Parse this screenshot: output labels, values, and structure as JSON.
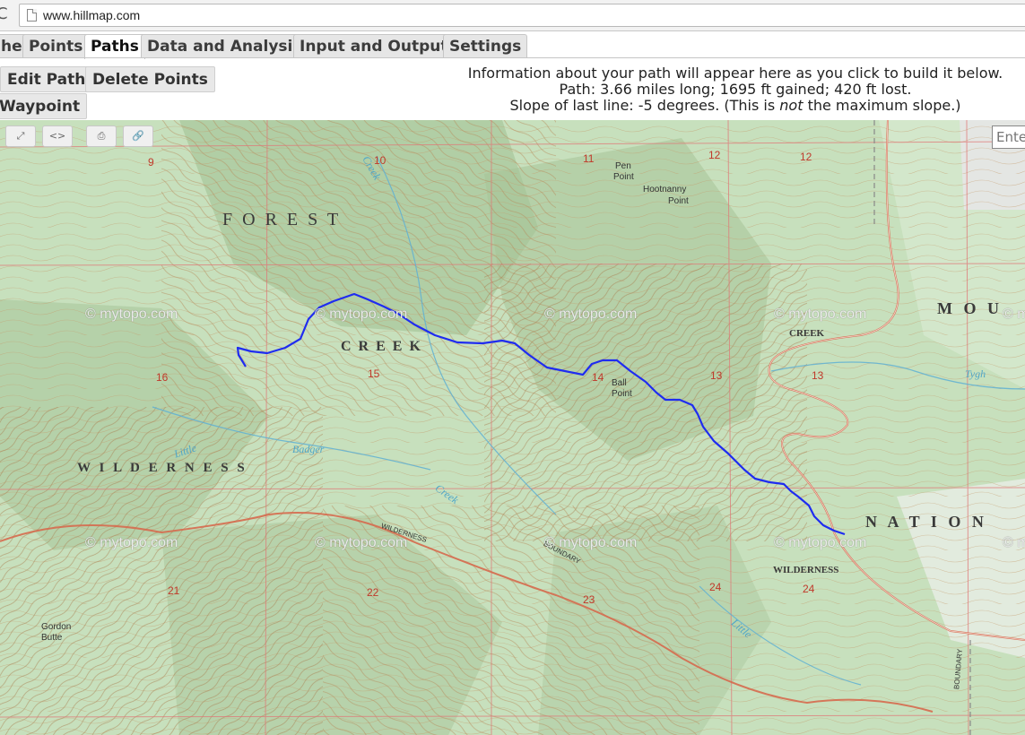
{
  "browser": {
    "url": "www.hillmap.com"
  },
  "tabs": [
    {
      "label": "he",
      "active": false
    },
    {
      "label": "Points",
      "active": false
    },
    {
      "label": "Paths",
      "active": true
    },
    {
      "label": "Data and Analysis",
      "active": false
    },
    {
      "label": "Input and Output",
      "active": false
    },
    {
      "label": "Settings",
      "active": false
    }
  ],
  "toolbar": {
    "edit_path": "Edit Path",
    "delete_points": "Delete Points",
    "waypoint": "Waypoint"
  },
  "info": {
    "line1": "Information about your path will appear here as you click to build it below.",
    "line2": "Path: 3.66 miles long; 1695 ft gained; 420 ft lost.",
    "line3_pre": "Slope of last line: -5 degrees. (This is ",
    "line3_em": "not",
    "line3_post": " the maximum slope.)"
  },
  "map": {
    "search_placeholder": "Ente",
    "controls": [
      "expand-icon",
      "code-icon",
      "print-icon",
      "link-icon"
    ],
    "watermark": "© mytopo.com",
    "labels": {
      "forest": "F O R E S T",
      "creek_big": "C R E E K",
      "wilderness_big": "W I L D E R N E S S",
      "nation": "N A T I O N",
      "mou": "M O U",
      "creek_small": "CREEK",
      "wilderness_small": "WILDERNESS",
      "boundary1": "BOUNDARY",
      "boundary2": "BOUNDARY",
      "wilderness_road": "WILDERNESS",
      "pen_point": "Pen",
      "pen_point2": "Point",
      "hootnanny": "Hootnanny",
      "hootnanny2": "Point",
      "ball_point": "Ball",
      "ball_point2": "Point",
      "gordon": "Gordon",
      "gordon2": "Butte",
      "little": "Little",
      "badger": "Badger",
      "creek_water": "Creek",
      "tygh": "Tygh",
      "creek_water_top": "Creek",
      "little_water": "Little"
    },
    "sections": [
      "9",
      "10",
      "11",
      "12",
      "12",
      "16",
      "15",
      "14",
      "13",
      "13",
      "21",
      "22",
      "23",
      "24",
      "24"
    ],
    "colors": {
      "path": "#1f2cf0",
      "grid": "#e07878",
      "contour": "#b98a5c",
      "vegetation": "#c6dfbc",
      "road": "#d66a4e"
    }
  }
}
